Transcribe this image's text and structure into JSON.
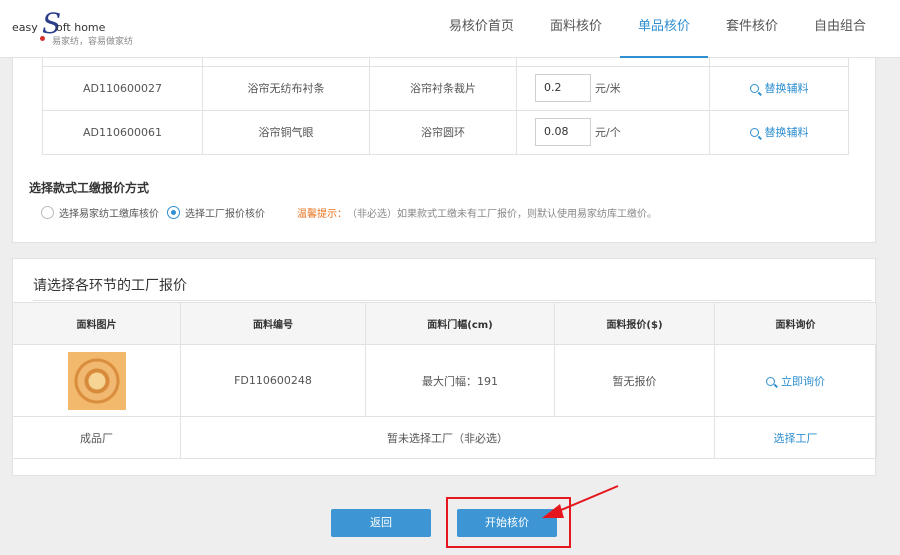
{
  "logo": {
    "easy": "easy",
    "s": "S",
    "oft": "oft home",
    "slogan": "易家纺，容易做家纺"
  },
  "nav": [
    "易核价首页",
    "面料核价",
    "单品核价",
    "套件核价",
    "自由组合"
  ],
  "accessories": [
    {
      "code": "AD110600027",
      "name": "浴帘无纺布衬条",
      "part": "浴帘衬条裁片",
      "price": "0.2",
      "unit": "元/米",
      "action": "替换辅料"
    },
    {
      "code": "AD110600061",
      "name": "浴帘铜气眼",
      "part": "浴帘圆环",
      "price": "0.08",
      "unit": "元/个",
      "action": "替换辅料"
    }
  ],
  "labor": {
    "title": "选择款式工缴报价方式",
    "option1": "选择易家纺工缴库核价",
    "option2": "选择工厂报价核价",
    "tip_label": "温馨提示：",
    "tip_text": "（非必选）如果款式工缴未有工厂报价，则默认使用易家纺库工缴价。"
  },
  "factory": {
    "title": "请选择各环节的工厂报价",
    "headers": [
      "面料图片",
      "面料编号",
      "面料门幅(cm)",
      "面料报价($)",
      "面料询价"
    ],
    "row": {
      "code": "FD110600248",
      "width": "最大门幅：191",
      "quote": "暂无报价",
      "action": "立即询价"
    },
    "maker": {
      "label": "成品厂",
      "value": "暂未选择工厂（非必选）",
      "action": "选择工厂"
    }
  },
  "buttons": {
    "back": "返回",
    "start": "开始核价"
  },
  "colors": {
    "accent": "#2f8fd0",
    "button": "#3d96d3",
    "tip": "#e8701a",
    "highlight": "#e5161d"
  }
}
